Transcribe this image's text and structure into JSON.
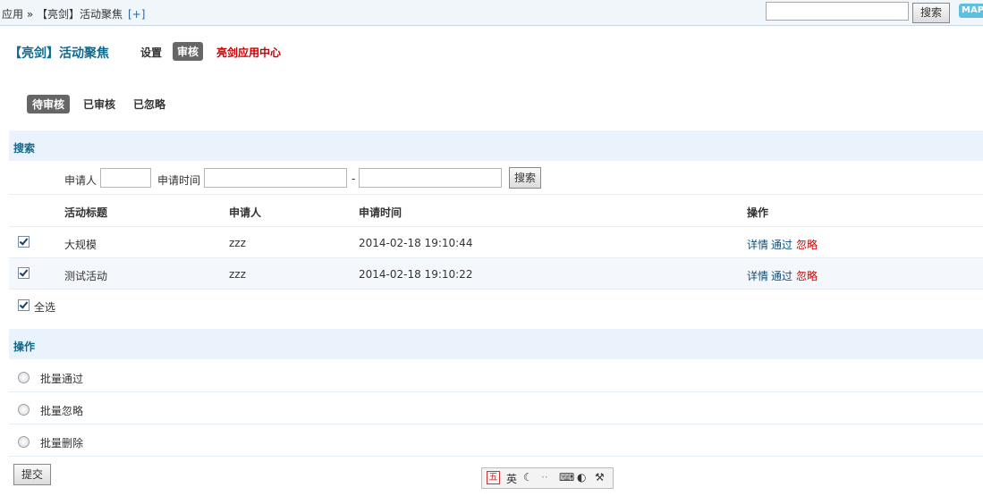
{
  "topbar": {
    "breadcrumb": "应用 » 【亮剑】活动聚焦",
    "add": "[+]",
    "search_value": "",
    "search_button": "搜索",
    "map_badge": "MAP"
  },
  "header": {
    "app_title": "【亮剑】活动聚焦",
    "nav_setting": "设置",
    "nav_review": "审核",
    "nav_center": "亮剑应用中心"
  },
  "subtabs": [
    "待审核",
    "已审核",
    "已忽略"
  ],
  "search_section": {
    "title": "搜索",
    "applicant_label": "申请人",
    "time_label": "申请时间",
    "separator": "-",
    "button": "搜索"
  },
  "table": {
    "headers": [
      "活动标题",
      "申请人",
      "申请时间",
      "操作"
    ],
    "rows": [
      {
        "title": "大规模",
        "applicant": "zzz",
        "time": "2014-02-18 19:10:44",
        "checked": true
      },
      {
        "title": "测试活动",
        "applicant": "zzz",
        "time": "2014-02-18 19:10:22",
        "checked": true
      }
    ],
    "action_detail": "详情",
    "action_pass": "通过",
    "action_ignore": "忽略",
    "select_all": "全选"
  },
  "ops_section": {
    "title": "操作",
    "options": [
      "批量通过",
      "批量忽略",
      "批量删除"
    ],
    "submit": "提交"
  },
  "ime": {
    "mode": "英"
  },
  "colors": {
    "accent": "#0f6a8f",
    "danger": "#cc0000",
    "section_bg": "#eaf3fb"
  }
}
